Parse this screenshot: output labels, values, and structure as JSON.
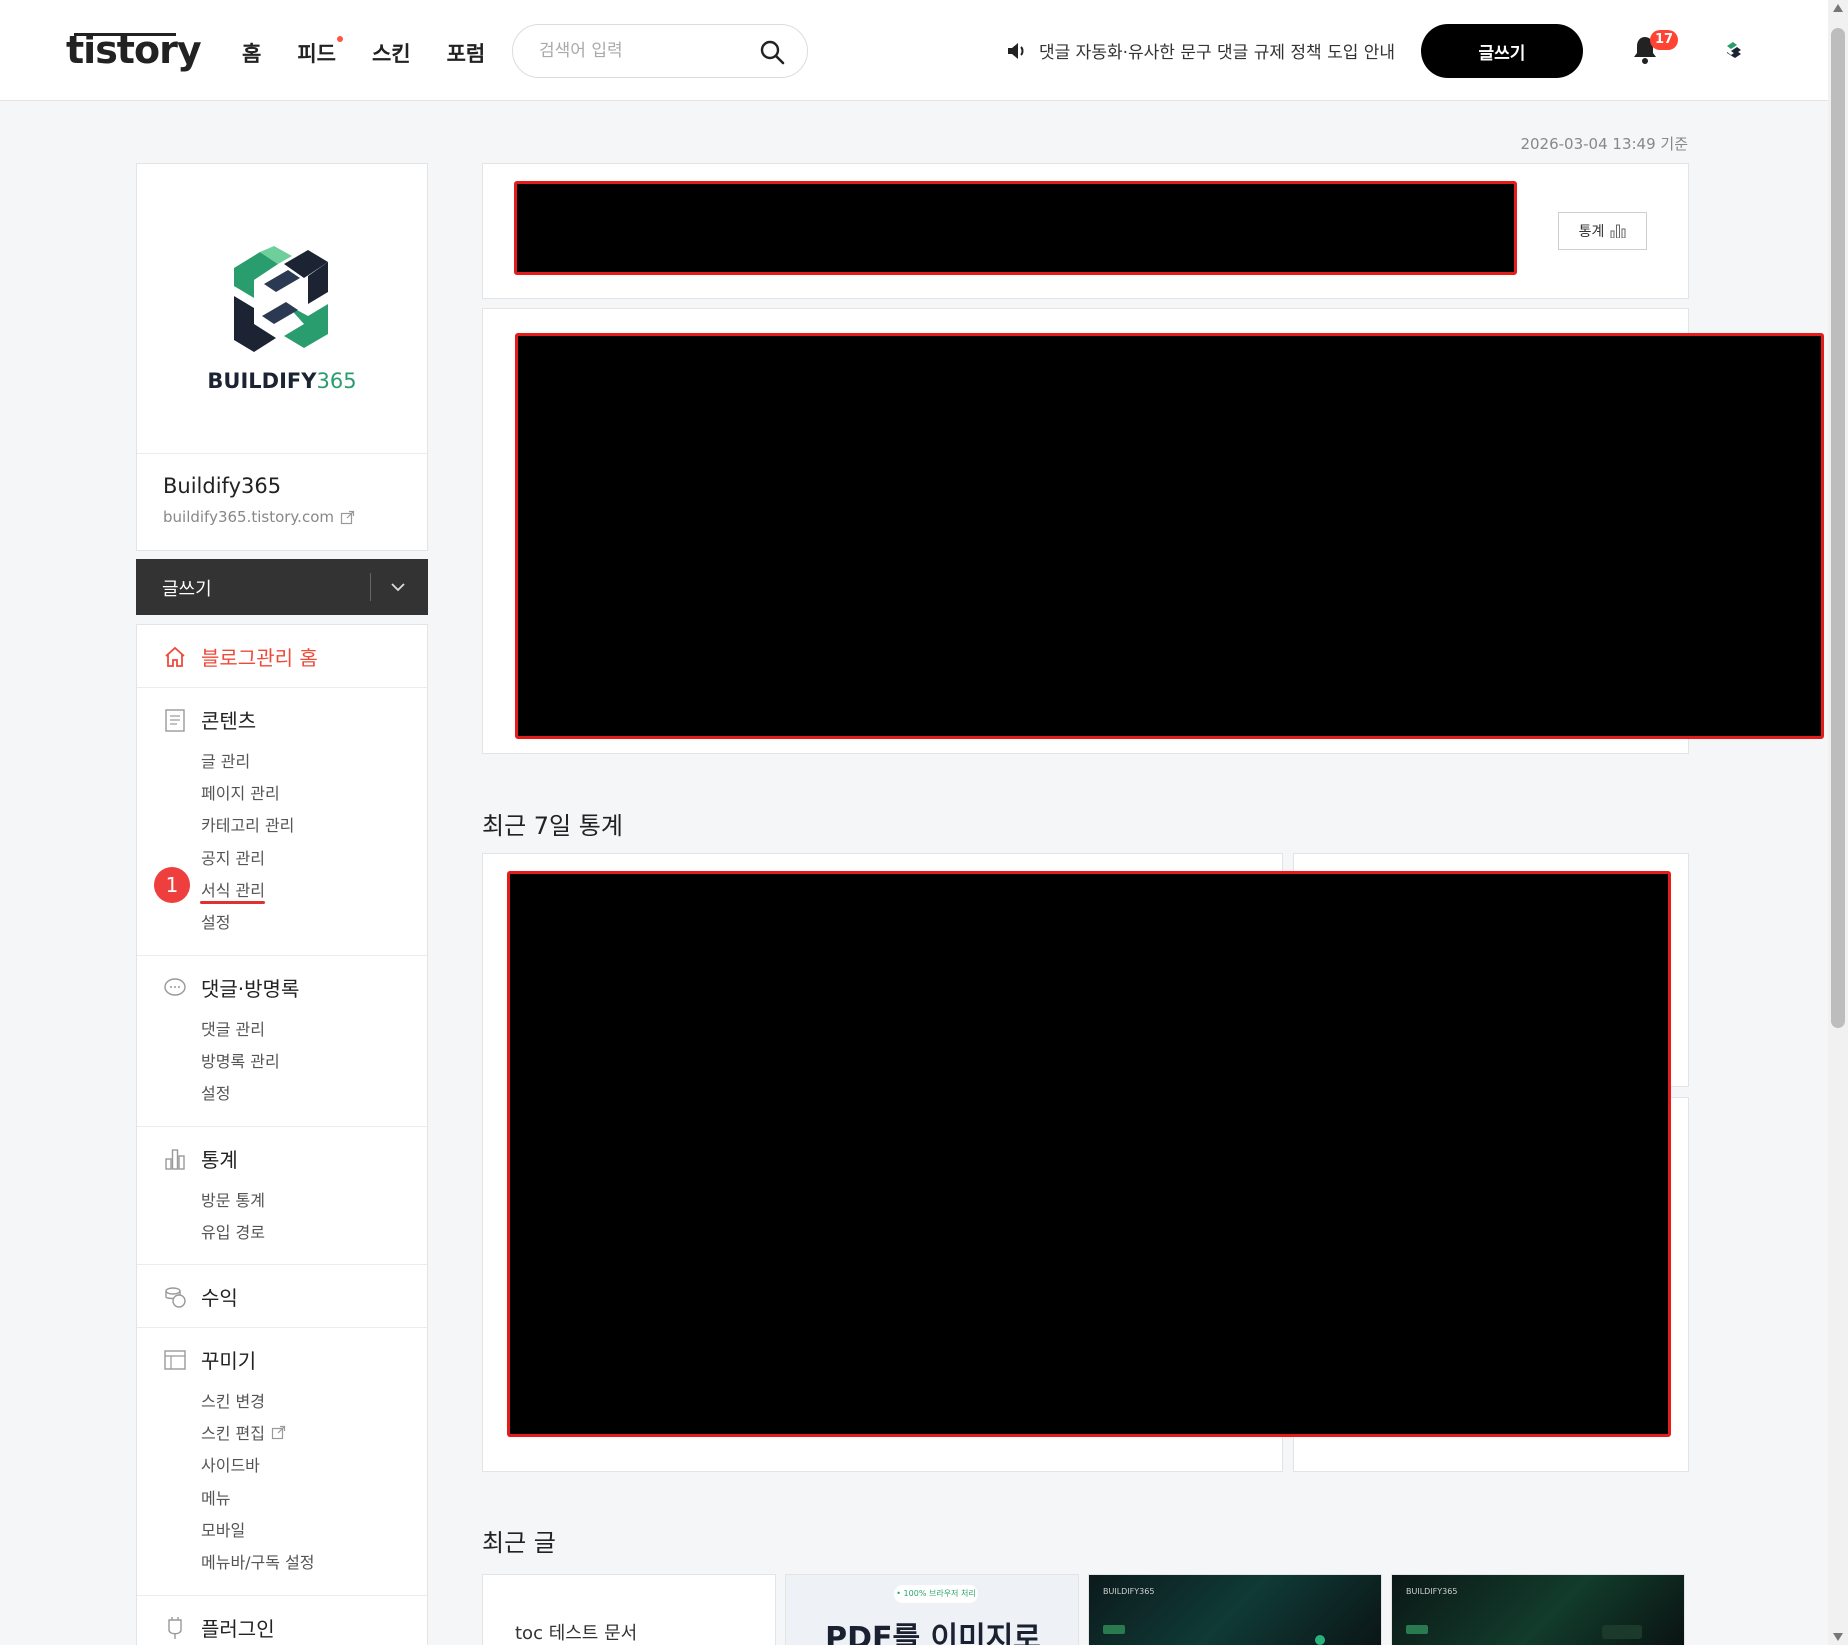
{
  "header": {
    "logo": "tistory",
    "nav": [
      "홈",
      "피드",
      "스킨",
      "포럼"
    ],
    "search_placeholder": "검색어 입력",
    "notice": "댓글 자동화·유사한 문구 댓글 규제 정책 도입 안내",
    "write_label": "글쓰기",
    "notification_count": "17"
  },
  "profile": {
    "brand_main": "BUILDIFY",
    "brand_num": "365",
    "blog_name": "Buildify365",
    "blog_url": "buildify365.tistory.com"
  },
  "sidebar": {
    "write_label": "글쓰기",
    "home": "블로그관리 홈",
    "content": {
      "title": "콘텐츠",
      "items": [
        "글 관리",
        "페이지 관리",
        "카테고리 관리",
        "공지 관리",
        "서식 관리",
        "설정"
      ]
    },
    "comments": {
      "title": "댓글·방명록",
      "items": [
        "댓글 관리",
        "방명록 관리",
        "설정"
      ]
    },
    "stats": {
      "title": "통계",
      "items": [
        "방문 통계",
        "유입 경로"
      ]
    },
    "revenue": {
      "title": "수익"
    },
    "decorate": {
      "title": "꾸미기",
      "items": [
        "스킨 변경",
        "스킨 편집",
        "사이드바",
        "메뉴",
        "모바일",
        "메뉴바/구독 설정"
      ]
    },
    "plugin": {
      "title": "플러그인"
    },
    "annotation_badge": "1"
  },
  "main": {
    "timestamp": "2026-03-04 13:49 기준",
    "stats_button": "통계",
    "section_weekly": "최근 7일 통계",
    "section_recent": "최근 글",
    "posts": [
      {
        "title": "toc 테스트 문서"
      },
      {
        "thumb_pill": "• 100% 브라우저 처리",
        "thumb_title": "PDF를 이미지로"
      },
      {
        "thumb_brand": "BUILDIFY365"
      },
      {
        "thumb_brand": "BUILDIFY365"
      }
    ]
  },
  "colors": {
    "accent_red": "#ee4a3a",
    "redaction_border": "#e41c1c",
    "brand_green": "#2a9d6f"
  }
}
